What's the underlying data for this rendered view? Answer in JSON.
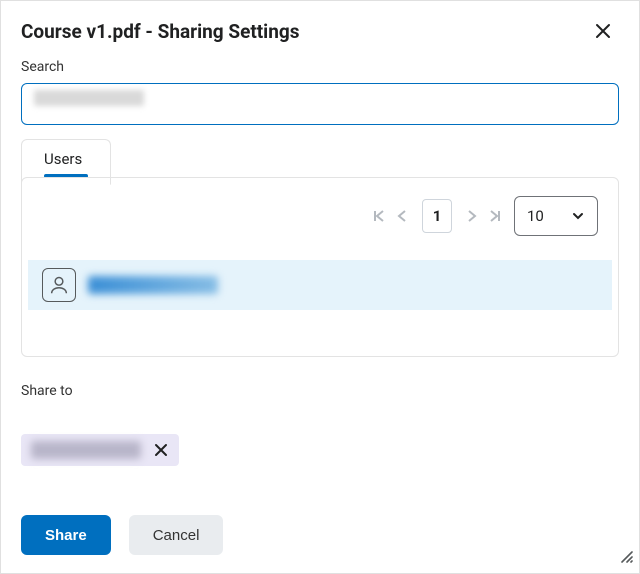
{
  "header": {
    "title": "Course v1.pdf - Sharing Settings"
  },
  "search": {
    "label": "Search",
    "value": ""
  },
  "tabs": [
    {
      "label": "Users"
    }
  ],
  "pagination": {
    "page": "1",
    "page_size": "10"
  },
  "users": [
    {
      "name": ""
    }
  ],
  "share_to": {
    "label": "Share to",
    "chips": [
      {
        "name": ""
      }
    ]
  },
  "footer": {
    "share_label": "Share",
    "cancel_label": "Cancel"
  }
}
